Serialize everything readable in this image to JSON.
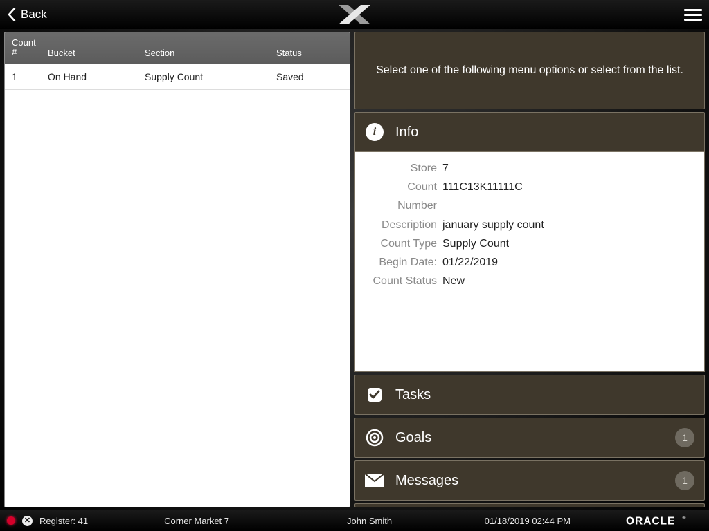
{
  "topbar": {
    "back_label": "Back"
  },
  "left": {
    "headers": {
      "count_no": "Count #",
      "bucket": "Bucket",
      "section": "Section",
      "status": "Status"
    },
    "rows": [
      {
        "count_no": "1",
        "bucket": "On Hand",
        "section": "Supply Count",
        "status": "Saved"
      }
    ]
  },
  "right": {
    "prompt": "Select one of the following menu options or select from the list.",
    "info": {
      "title": "Info",
      "fields": {
        "store": {
          "label": "Store",
          "value": "7"
        },
        "count_number": {
          "label": "Count Number",
          "value": "111C13K11111C"
        },
        "description": {
          "label": "Description",
          "value": "january supply count"
        },
        "count_type": {
          "label": "Count Type",
          "value": "Supply Count"
        },
        "begin_date": {
          "label": "Begin Date:",
          "value": "01/22/2019"
        },
        "count_status": {
          "label": "Count Status",
          "value": "New"
        }
      }
    },
    "menu": {
      "tasks": {
        "label": "Tasks"
      },
      "goals": {
        "label": "Goals",
        "badge": "1"
      },
      "messages": {
        "label": "Messages",
        "badge": "1"
      }
    }
  },
  "statusbar": {
    "register": "Register: 41",
    "store": "Corner Market 7",
    "user": "John Smith",
    "datetime": "01/18/2019 02:44 PM",
    "brand": "ORACLE"
  }
}
